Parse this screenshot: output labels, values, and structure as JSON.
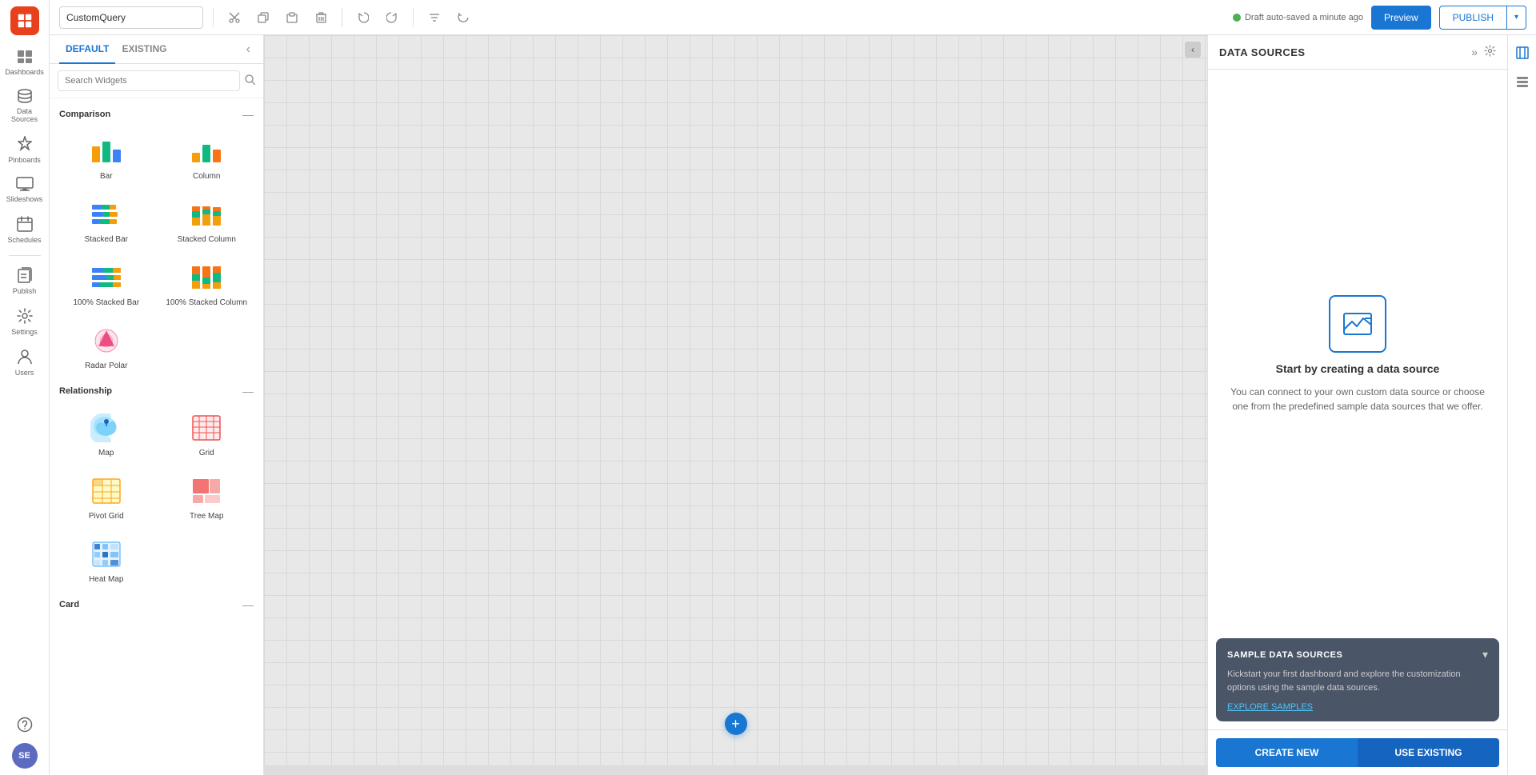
{
  "app": {
    "query_name": "CustomQuery",
    "autosave_text": "Draft auto-saved a minute ago",
    "preview_label": "Preview",
    "publish_label": "PUBLISH"
  },
  "nav": {
    "items": [
      {
        "label": "Dashboards",
        "icon": "⊞"
      },
      {
        "label": "Data Sources",
        "icon": "🗄"
      },
      {
        "label": "Pinboards",
        "icon": "📌"
      },
      {
        "label": "Slideshows",
        "icon": "🎬"
      },
      {
        "label": "Schedules",
        "icon": "📅"
      },
      {
        "label": "Publish",
        "icon": "↗"
      },
      {
        "label": "Settings",
        "icon": "⚙"
      },
      {
        "label": "Users",
        "icon": "👤"
      }
    ],
    "bottom": [
      {
        "label": "Help",
        "icon": "?"
      },
      {
        "label": "Avatar",
        "initials": "SE"
      }
    ]
  },
  "widget_panel": {
    "tabs": [
      {
        "label": "DEFAULT",
        "active": true
      },
      {
        "label": "EXISTING",
        "active": false
      }
    ],
    "search_placeholder": "Search Widgets",
    "sections": [
      {
        "title": "Comparison",
        "widgets": [
          {
            "label": "Bar",
            "type": "bar"
          },
          {
            "label": "Column",
            "type": "column"
          },
          {
            "label": "Stacked Bar",
            "type": "stacked-bar"
          },
          {
            "label": "Stacked Column",
            "type": "stacked-column"
          },
          {
            "label": "100% Stacked Bar",
            "type": "100-stacked-bar"
          },
          {
            "label": "100% Stacked Column",
            "type": "100-stacked-column"
          },
          {
            "label": "Radar Polar",
            "type": "radar-polar"
          }
        ]
      },
      {
        "title": "Relationship",
        "widgets": [
          {
            "label": "Map",
            "type": "map"
          },
          {
            "label": "Grid",
            "type": "grid"
          },
          {
            "label": "Pivot Grid",
            "type": "pivot-grid"
          },
          {
            "label": "Tree Map",
            "type": "tree-map"
          },
          {
            "label": "Heat Map",
            "type": "heat-map"
          }
        ]
      },
      {
        "title": "Card",
        "widgets": []
      }
    ]
  },
  "data_sources": {
    "title": "DATA SOURCES",
    "empty_title": "Start by creating a data source",
    "empty_desc": "You can connect to your own custom data source or choose one from the predefined sample data sources that we offer.",
    "sample": {
      "title": "SAMPLE DATA SOURCES",
      "desc": "Kickstart your first dashboard and explore the customization options using the sample data sources.",
      "link": "EXPLORE SAMPLES"
    },
    "btn_create": "CREATE NEW",
    "btn_existing": "USE EXISTING"
  }
}
